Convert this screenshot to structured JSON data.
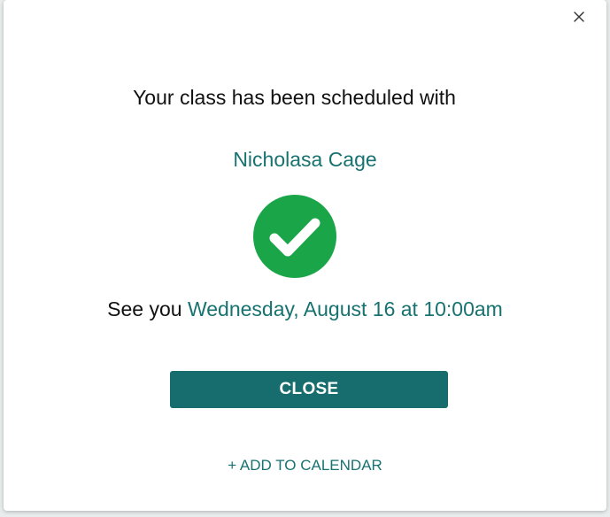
{
  "modal": {
    "heading": "Your class has been scheduled with",
    "instructor_name": "Nicholasa Cage",
    "see_you_prefix": "See you",
    "appointment_time": "Wednesday, August 16 at 10:00am",
    "close_button_label": "CLOSE",
    "add_to_calendar_label": "+ ADD TO CALENDAR",
    "icons": {
      "dismiss": "close-x-icon",
      "success": "check-circle-icon"
    },
    "colors": {
      "accent": "#177270",
      "button": "#176d6d",
      "success": "#1aa648",
      "text": "#111111"
    }
  }
}
